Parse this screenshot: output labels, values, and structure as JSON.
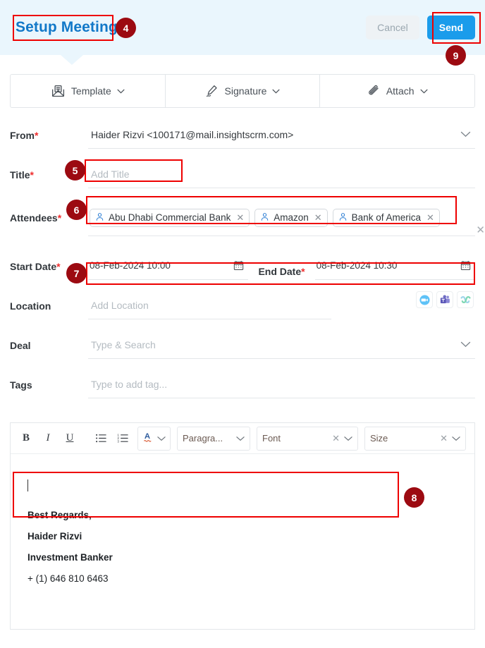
{
  "header": {
    "title": "Setup Meeting",
    "cancel_label": "Cancel",
    "send_label": "Send"
  },
  "compose_tools": [
    {
      "label": "Template",
      "icon": "template-envelope-icon"
    },
    {
      "label": "Signature",
      "icon": "signature-pen-icon"
    },
    {
      "label": "Attach",
      "icon": "attach-paperclip-icon"
    }
  ],
  "form": {
    "from": {
      "label": "From",
      "required": "*",
      "value": "Haider Rizvi <100171@mail.insightscrm.com>"
    },
    "title": {
      "label": "Title",
      "required": "*",
      "placeholder": "Add Title",
      "value": ""
    },
    "attendees": {
      "label": "Attendees",
      "required": "*",
      "chips": [
        {
          "name": "Abu Dhabi Commercial Bank"
        },
        {
          "name": "Amazon"
        },
        {
          "name": "Bank of America"
        }
      ],
      "remove_glyph": "✕",
      "clear_all_glyph": "✕"
    },
    "start_date": {
      "label": "Start Date",
      "required": "*",
      "value": "08-Feb-2024 10:00"
    },
    "end_date": {
      "label": "End Date",
      "required": "*",
      "value": "08-Feb-2024 10:30"
    },
    "location": {
      "label": "Location",
      "placeholder": "Add Location",
      "value": "",
      "providers": [
        {
          "name": "zoom-icon",
          "color": "#4fb3f7"
        },
        {
          "name": "microsoft-teams-icon",
          "color": "#6b69c8"
        },
        {
          "name": "webex-icon",
          "color": "#6fd5b6"
        }
      ]
    },
    "deal": {
      "label": "Deal",
      "placeholder": "Type & Search",
      "value": ""
    },
    "tags": {
      "label": "Tags",
      "placeholder": "Type to add tag...",
      "value": ""
    }
  },
  "editor": {
    "toolbar": {
      "bold": "B",
      "italic": "I",
      "underline": "U",
      "bullet_list": "bullet-list-icon",
      "numbered_list": "numbered-list-icon",
      "font_color": "A",
      "paragraph_select": "Paragra...",
      "font_select": "Font",
      "size_select": "Size",
      "clear_glyph": "✕",
      "caret_glyph": "⌄"
    },
    "body": {
      "content": "",
      "signature": [
        "Best Regards,",
        "Haider Rizvi",
        "Investment Banker",
        "+ (1) 646 810 6463"
      ]
    }
  },
  "annotations": [
    {
      "number": "4",
      "target": "page-title"
    },
    {
      "number": "5",
      "target": "title-field"
    },
    {
      "number": "6",
      "target": "attendees-field"
    },
    {
      "number": "7",
      "target": "date-fields"
    },
    {
      "number": "8",
      "target": "editor-body"
    },
    {
      "number": "9",
      "target": "send-button"
    }
  ],
  "colors": {
    "title_blue": "#1178c8",
    "send_blue": "#1a9ceb",
    "header_bg": "#eaf6fd",
    "annotation_red": "#ee0000",
    "badge_red": "#9c0a11",
    "required_red": "#ef2e2e"
  }
}
